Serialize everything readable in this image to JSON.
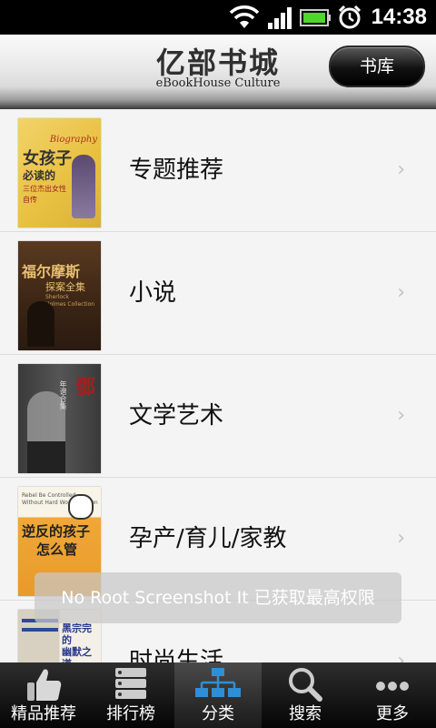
{
  "status_bar": {
    "time": "14:38"
  },
  "header": {
    "title": "亿部书城",
    "subtitle": "eBookHouse Culture",
    "library_button": "书库"
  },
  "categories": [
    {
      "label": "专题推荐",
      "cover": {
        "title": "女孩子",
        "subtitle": "必读的",
        "lines": [
          "三位杰出女性",
          "自传"
        ],
        "tag": "Biography"
      }
    },
    {
      "label": "小说",
      "cover": {
        "title": "福尔摩斯",
        "subtitle": "探案全集",
        "lines": [
          "Sherlock",
          "Holmes Collection"
        ]
      }
    },
    {
      "label": "文学艺术",
      "cover": {
        "title": "鄧",
        "subtitle": "年谱合集",
        "lines": []
      }
    },
    {
      "label": "孕产/育儿/家教",
      "cover": {
        "title": "逆反的孩子",
        "subtitle": "怎么管",
        "lines": [
          "Rebel Be Controlled Without Hard Work Children"
        ]
      }
    },
    {
      "label": "时尚生活",
      "cover": {
        "title": "黑宗完的",
        "subtitle": "幽默之道",
        "lines": []
      }
    }
  ],
  "toast": "No Root Screenshot It 已获取最高权限",
  "tabs": [
    {
      "label": "精品推荐",
      "icon": "thumbs-up-icon"
    },
    {
      "label": "排行榜",
      "icon": "ranking-icon"
    },
    {
      "label": "分类",
      "icon": "category-tree-icon",
      "active": true
    },
    {
      "label": "搜索",
      "icon": "search-icon"
    },
    {
      "label": "更多",
      "icon": "more-icon"
    }
  ],
  "colors": {
    "accent": "#2f8fd6",
    "header_text": "#303030",
    "tab_bg": "#111111"
  }
}
